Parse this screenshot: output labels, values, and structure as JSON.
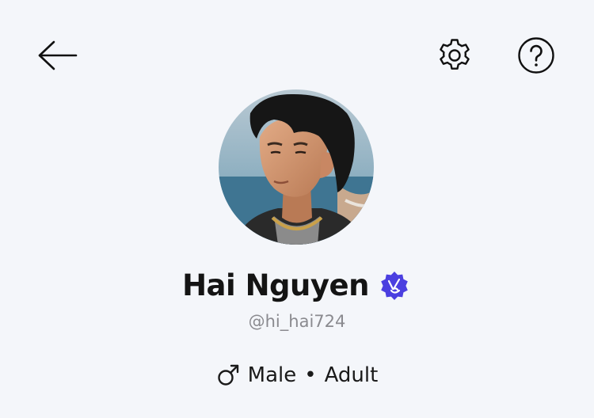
{
  "header": {
    "back_icon": "arrow-left-icon",
    "settings_icon": "gear-icon",
    "help_icon": "question-circle-icon"
  },
  "profile": {
    "name": "Hai Nguyen",
    "verified_icon": "verified-badge-icon",
    "handle": "@hi_hai724",
    "gender_symbol": "♂",
    "gender": "Male",
    "separator": "•",
    "age_group": "Adult"
  },
  "colors": {
    "background": "#f4f6fa",
    "badge": "#4b3fe0",
    "name": "#141414",
    "handle": "#8a8a8f"
  }
}
